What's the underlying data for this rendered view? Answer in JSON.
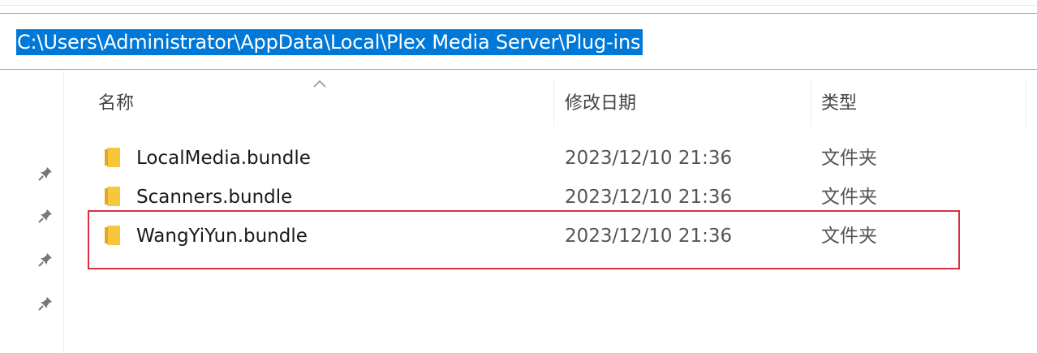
{
  "address_bar": {
    "path": "C:\\Users\\Administrator\\AppData\\Local\\Plex Media Server\\Plug-ins"
  },
  "columns": {
    "name": "名称",
    "modified": "修改日期",
    "type": "类型"
  },
  "files": [
    {
      "name": "LocalMedia.bundle",
      "modified": "2023/12/10 21:36",
      "type": "文件夹"
    },
    {
      "name": "Scanners.bundle",
      "modified": "2023/12/10 21:36",
      "type": "文件夹"
    },
    {
      "name": "WangYiYun.bundle",
      "modified": "2023/12/10 21:36",
      "type": "文件夹"
    }
  ],
  "icons": {
    "file_icon": "folder-icon",
    "nav_icon": "pin-icon",
    "sort_indicator": "sort-ascending-icon"
  },
  "colors": {
    "selection": "#0078d7",
    "address_border": "#7fb0e3",
    "folder": "#f8c63a",
    "annotation_box": "#d9323e"
  }
}
